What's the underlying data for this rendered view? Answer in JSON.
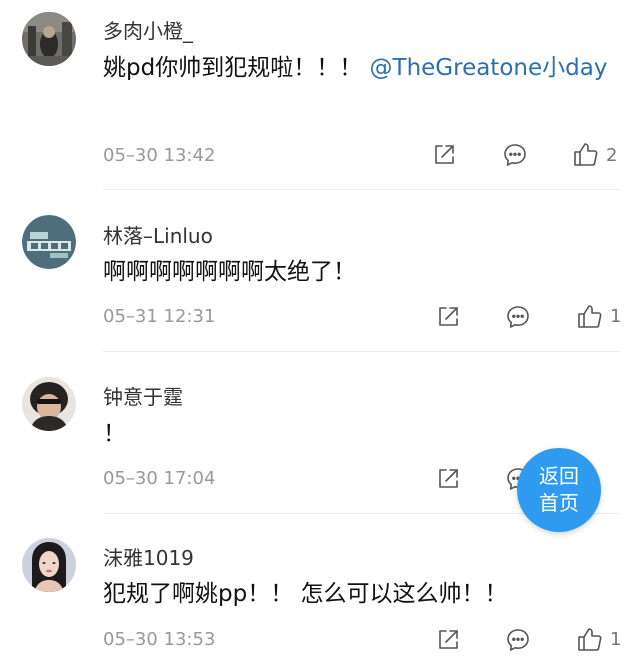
{
  "comments": [
    {
      "username": "多肉小橙_",
      "text_part1": "姚pd你帅到犯规啦！！！",
      "mention": "@TheGreatone小day",
      "time": "05–30 13:42",
      "like_count": "2"
    },
    {
      "username": "林落–Linluo",
      "text": "啊啊啊啊啊啊啊太绝了！",
      "time": "05–31 12:31",
      "like_count": "1"
    },
    {
      "username": "钟意于霆",
      "text": "！",
      "time": "05–30 17:04",
      "like_count": ""
    },
    {
      "username": "沫雅1019",
      "text": "犯规了啊姚pp！！ 怎么可以这么帅！！",
      "time": "05–30 13:53",
      "like_count": "1"
    }
  ],
  "back_to_home": {
    "line1": "返回",
    "line2": "首页"
  },
  "colors": {
    "mention": "#2a6fb3",
    "fab": "#2f9bf0"
  }
}
